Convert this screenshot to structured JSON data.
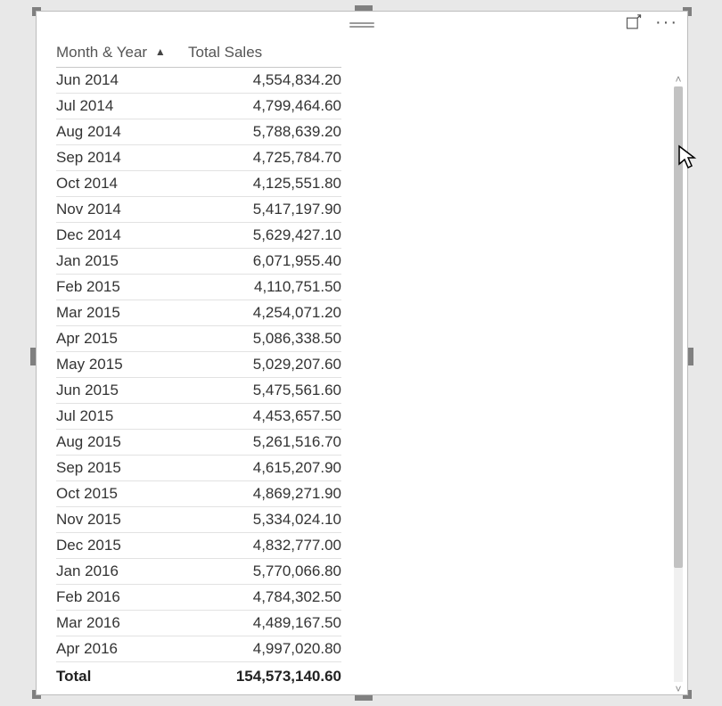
{
  "chart_data": {
    "type": "table",
    "columns": [
      "Month & Year",
      "Total Sales"
    ],
    "rows": [
      [
        "Jun 2014",
        4554834.2
      ],
      [
        "Jul 2014",
        4799464.6
      ],
      [
        "Aug 2014",
        5788639.2
      ],
      [
        "Sep 2014",
        4725784.7
      ],
      [
        "Oct 2014",
        4125551.8
      ],
      [
        "Nov 2014",
        5417197.9
      ],
      [
        "Dec 2014",
        5629427.1
      ],
      [
        "Jan 2015",
        6071955.4
      ],
      [
        "Feb 2015",
        4110751.5
      ],
      [
        "Mar 2015",
        4254071.2
      ],
      [
        "Apr 2015",
        5086338.5
      ],
      [
        "May 2015",
        5029207.6
      ],
      [
        "Jun 2015",
        5475561.6
      ],
      [
        "Jul 2015",
        4453657.5
      ],
      [
        "Aug 2015",
        5261516.7
      ],
      [
        "Sep 2015",
        4615207.9
      ],
      [
        "Oct 2015",
        4869271.9
      ],
      [
        "Nov 2015",
        5334024.1
      ],
      [
        "Dec 2015",
        4832777.0
      ],
      [
        "Jan 2016",
        5770066.8
      ],
      [
        "Feb 2016",
        4784302.5
      ],
      [
        "Mar 2016",
        4489167.5
      ],
      [
        "Apr 2016",
        4997020.8
      ]
    ],
    "total": [
      "Total",
      154573140.6
    ]
  },
  "header": {
    "col_month": "Month & Year",
    "col_sales": "Total Sales",
    "sort_indicator": "▲"
  },
  "rows": [
    {
      "month": "Jun 2014",
      "sales": "4,554,834.20"
    },
    {
      "month": "Jul 2014",
      "sales": "4,799,464.60"
    },
    {
      "month": "Aug 2014",
      "sales": "5,788,639.20"
    },
    {
      "month": "Sep 2014",
      "sales": "4,725,784.70"
    },
    {
      "month": "Oct 2014",
      "sales": "4,125,551.80"
    },
    {
      "month": "Nov 2014",
      "sales": "5,417,197.90"
    },
    {
      "month": "Dec 2014",
      "sales": "5,629,427.10"
    },
    {
      "month": "Jan 2015",
      "sales": "6,071,955.40"
    },
    {
      "month": "Feb 2015",
      "sales": "4,110,751.50"
    },
    {
      "month": "Mar 2015",
      "sales": "4,254,071.20"
    },
    {
      "month": "Apr 2015",
      "sales": "5,086,338.50"
    },
    {
      "month": "May 2015",
      "sales": "5,029,207.60"
    },
    {
      "month": "Jun 2015",
      "sales": "5,475,561.60"
    },
    {
      "month": "Jul 2015",
      "sales": "4,453,657.50"
    },
    {
      "month": "Aug 2015",
      "sales": "5,261,516.70"
    },
    {
      "month": "Sep 2015",
      "sales": "4,615,207.90"
    },
    {
      "month": "Oct 2015",
      "sales": "4,869,271.90"
    },
    {
      "month": "Nov 2015",
      "sales": "5,334,024.10"
    },
    {
      "month": "Dec 2015",
      "sales": "4,832,777.00"
    },
    {
      "month": "Jan 2016",
      "sales": "5,770,066.80"
    },
    {
      "month": "Feb 2016",
      "sales": "4,784,302.50"
    },
    {
      "month": "Mar 2016",
      "sales": "4,489,167.50"
    },
    {
      "month": "Apr 2016",
      "sales": "4,997,020.80"
    }
  ],
  "total": {
    "label": "Total",
    "value": "154,573,140.60"
  },
  "scroll": {
    "up": "˄",
    "down": "˅"
  }
}
